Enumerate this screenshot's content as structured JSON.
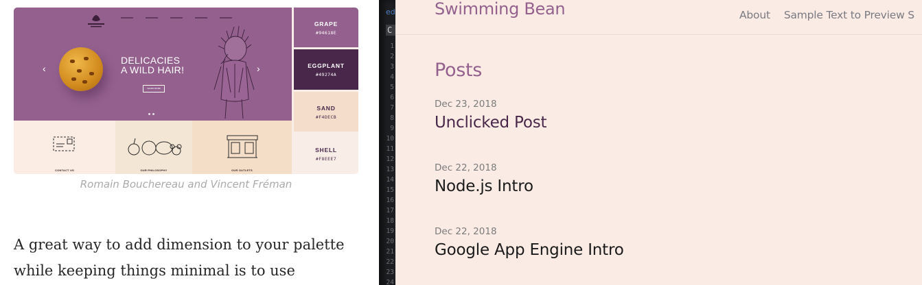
{
  "article": {
    "hero": {
      "title": "DELICACIES\nA WILD HAIR!",
      "button": "LEARN MORE",
      "prev_arrow": "‹",
      "next_arrow": "›"
    },
    "tiles": [
      {
        "label": "CONTACT US",
        "color": "#FBECE4"
      },
      {
        "label": "OUR PHILOSOPHY",
        "color": "#F4E6D5"
      },
      {
        "label": "OUR OUTLETS",
        "color": "#F4DEC8"
      }
    ],
    "swatches": [
      {
        "name": "GRAPE",
        "hex": "#94618E",
        "text_color": "#ffffff"
      },
      {
        "name": "EGGPLANT",
        "hex": "#49274A",
        "text_color": "#ffffff"
      },
      {
        "name": "SAND",
        "hex": "#F4DECB",
        "text_color": "#49274A"
      },
      {
        "name": "SHELL",
        "hex": "#F8EEE7",
        "text_color": "#49274A"
      }
    ],
    "caption": "Romain Bouchereau and Vincent Fréman",
    "paragraph": "A great way to add dimension to your palette while keeping things minimal is to use"
  },
  "editor": {
    "tab_fragment": "ed",
    "symbol": "C",
    "line_numbers": [
      "1",
      "2",
      "3",
      "4",
      "5",
      "6",
      "7",
      "8",
      "9",
      "10",
      "11",
      "12",
      "13",
      "14",
      "15",
      "16",
      "17",
      "18",
      "19",
      "20",
      "21",
      "22",
      "23",
      "24"
    ]
  },
  "blog": {
    "site_title": "Swimming Bean",
    "nav": [
      "About",
      "Sample Text to Preview S"
    ],
    "section_title": "Posts",
    "posts": [
      {
        "date": "Dec 23, 2018",
        "title": "Unclicked Post",
        "color": "#49274A"
      },
      {
        "date": "Dec 22, 2018",
        "title": "Node.js Intro",
        "color": "#1a1a1a"
      },
      {
        "date": "Dec 22, 2018",
        "title": "Google App Engine Intro",
        "color": "#1a1a1a"
      }
    ]
  },
  "colors": {
    "grape": "#94618E",
    "eggplant": "#49274A",
    "sand": "#F4DECB",
    "shell": "#F8EEE7"
  }
}
